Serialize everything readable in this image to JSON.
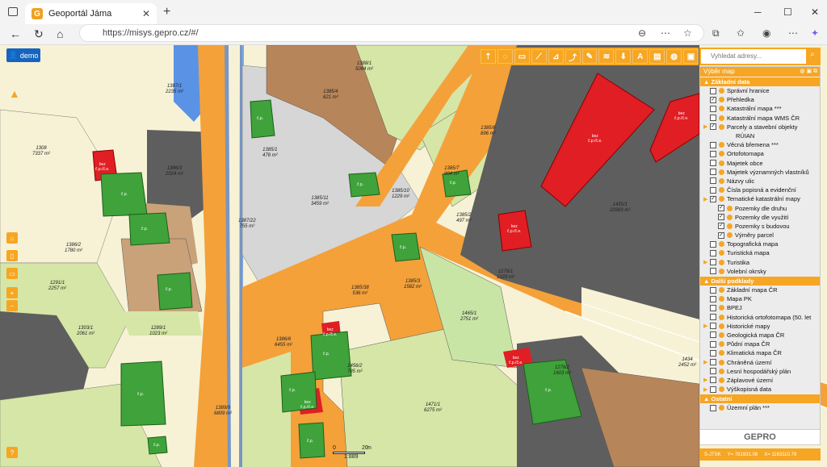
{
  "browser": {
    "tab_title": "Geoportál Jáma",
    "url": "https://misys.gepro.cz/#/",
    "favicon_letter": "G"
  },
  "app": {
    "demo_label": "demo",
    "search_placeholder": "Vyhledat adresy...",
    "panel_title": "Výběr map",
    "logo_text": "GEPRO",
    "coord_system": "S-JTSK",
    "coord_y": "Y= 781931.08",
    "coord_x": "X= 1163110.79",
    "scale_labels": [
      "0",
      "20",
      "1:889",
      "m"
    ]
  },
  "toolbar": {
    "tools": [
      "ruler-icon",
      "speech-icon",
      "id-card-icon",
      "measure-line-icon",
      "measure-area-icon",
      "profile-icon",
      "draw-icon",
      "layers-icon",
      "marker-icon",
      "text-icon",
      "print-icon",
      "globe-icon",
      "document-icon"
    ],
    "tool_glyphs": [
      "⇡",
      "◌",
      "▭",
      "⟋",
      "⊿",
      "⤴",
      "✎",
      "≋",
      "⬇",
      "A",
      "▤",
      "◍",
      "▣"
    ]
  },
  "layers": {
    "sections": [
      {
        "title": "Základní data",
        "items": [
          {
            "label": "Správní hranice",
            "checked": false,
            "level": 0
          },
          {
            "label": "Přehledka",
            "checked": true,
            "level": 0
          },
          {
            "label": "Katastrální mapa ***",
            "checked": false,
            "level": 0
          },
          {
            "label": "Katastrální mapa WMS ČR",
            "checked": false,
            "level": 0
          },
          {
            "label": "Parcely a stavební objekty",
            "checked": true,
            "level": 0,
            "expandable": true
          },
          {
            "label": "RÚIAN",
            "checked": null,
            "level": 2
          },
          {
            "label": "Věcná břemena ***",
            "checked": false,
            "level": 0
          },
          {
            "label": "Ortofotomapa",
            "checked": false,
            "level": 0
          },
          {
            "label": "Majetek obce",
            "checked": false,
            "level": 0
          },
          {
            "label": "Majetek významných vlastníků",
            "checked": false,
            "level": 0
          },
          {
            "label": "Názvy ulic",
            "checked": false,
            "level": 0
          },
          {
            "label": "Čísla popisná a evidenční",
            "checked": false,
            "level": 0
          },
          {
            "label": "Tematické katastrální mapy",
            "checked": true,
            "level": 0,
            "expandable": true
          },
          {
            "label": "Pozemky dle druhu",
            "checked": true,
            "level": 1
          },
          {
            "label": "Pozemky dle využití",
            "checked": true,
            "level": 1
          },
          {
            "label": "Pozemky s budovou",
            "checked": true,
            "level": 1
          },
          {
            "label": "Výměry parcel",
            "checked": true,
            "level": 1
          },
          {
            "label": "Topografická mapa",
            "checked": false,
            "level": 0
          },
          {
            "label": "Turistická mapa",
            "checked": false,
            "level": 0
          },
          {
            "label": "Turistika",
            "checked": false,
            "level": 0,
            "expandable": true
          },
          {
            "label": "Volební okrsky",
            "checked": false,
            "level": 0
          }
        ]
      },
      {
        "title": "Další podklady",
        "items": [
          {
            "label": "Základní mapa ČR",
            "checked": false,
            "level": 0
          },
          {
            "label": "Mapa PK",
            "checked": false,
            "level": 0
          },
          {
            "label": "BPEJ",
            "checked": false,
            "level": 0
          },
          {
            "label": "Historická ortofotomapa (50. let",
            "checked": false,
            "level": 0
          },
          {
            "label": "Historické mapy",
            "checked": false,
            "level": 0,
            "expandable": true
          },
          {
            "label": "Geologická mapa ČR",
            "checked": false,
            "level": 0
          },
          {
            "label": "Půdní mapa ČR",
            "checked": false,
            "level": 0
          },
          {
            "label": "Klimatická mapa ČR",
            "checked": false,
            "level": 0
          },
          {
            "label": "Chráněná území",
            "checked": false,
            "level": 0,
            "expandable": true
          },
          {
            "label": "Lesní hospodářský plán",
            "checked": false,
            "level": 0
          },
          {
            "label": "Záplavové území",
            "checked": false,
            "level": 0,
            "expandable": true
          },
          {
            "label": "Výškopisná data",
            "checked": false,
            "level": 0,
            "expandable": true
          }
        ]
      },
      {
        "title": "Ostatní",
        "items": [
          {
            "label": "Územní plán ***",
            "checked": false,
            "level": 0
          }
        ]
      }
    ]
  },
  "parcels": [
    {
      "num": "1387/1",
      "area": "2235 m²"
    },
    {
      "num": "1388/1",
      "area": "5064 m²"
    },
    {
      "num": "1308",
      "area": "7337 m²"
    },
    {
      "num": "1386/3",
      "area": "2024 m²"
    },
    {
      "num": "1386/2",
      "area": "1780 m²"
    },
    {
      "num": "1291/1",
      "area": "2257 m²"
    },
    {
      "num": "1289/1",
      "area": "1023 m²"
    },
    {
      "num": "1303/1",
      "area": "2061 m²"
    },
    {
      "num": "1387/22",
      "area": "755 m²"
    },
    {
      "num": "1385/10",
      "area": "1229 m²"
    },
    {
      "num": "1385/11",
      "area": "3459 m²"
    },
    {
      "num": "1385/7",
      "area": "904 m²"
    },
    {
      "num": "1385/8",
      "area": "896 m²"
    },
    {
      "num": "1435/1",
      "area": "20383 m²"
    },
    {
      "num": "1276/1",
      "area": "1029 m²"
    },
    {
      "num": "1465/1",
      "area": "2751 m²"
    },
    {
      "num": "1386/6",
      "area": "6455 m²"
    },
    {
      "num": "1471/1",
      "area": "6275 m²"
    },
    {
      "num": "1456/2",
      "area": "785 m²"
    },
    {
      "num": "1385/38",
      "area": "536 m²"
    },
    {
      "num": "1385/3",
      "area": "1582 m²"
    },
    {
      "num": "1434",
      "area": "2452 m²"
    },
    {
      "num": "1389/9",
      "area": "6809 m²"
    },
    {
      "num": "1385/4",
      "area": "621 m²"
    },
    {
      "num": "1276/2",
      "area": "1603 m²"
    },
    {
      "num": "1385/2",
      "area": "497 m²"
    },
    {
      "num": "1385/1",
      "area": "478 m²"
    }
  ],
  "building_labels": {
    "red": "bez\nč.p./č.e.",
    "green": "č.p."
  },
  "colors": {
    "accent": "#f6a623",
    "road": "#f4a13a",
    "field": "#d6e6a6",
    "garden": "#c8e5a6",
    "yard": "#8c8c8c",
    "dark_area": "#5e5e5e",
    "light_grey": "#d6d6d6",
    "building_red": "#e01e24",
    "building_green": "#3fa23a",
    "tan": "#c9a27a",
    "brown": "#b7855a",
    "pale": "#f7f2d6",
    "water": "#5a93e6",
    "demo_blue": "#1565c0"
  }
}
